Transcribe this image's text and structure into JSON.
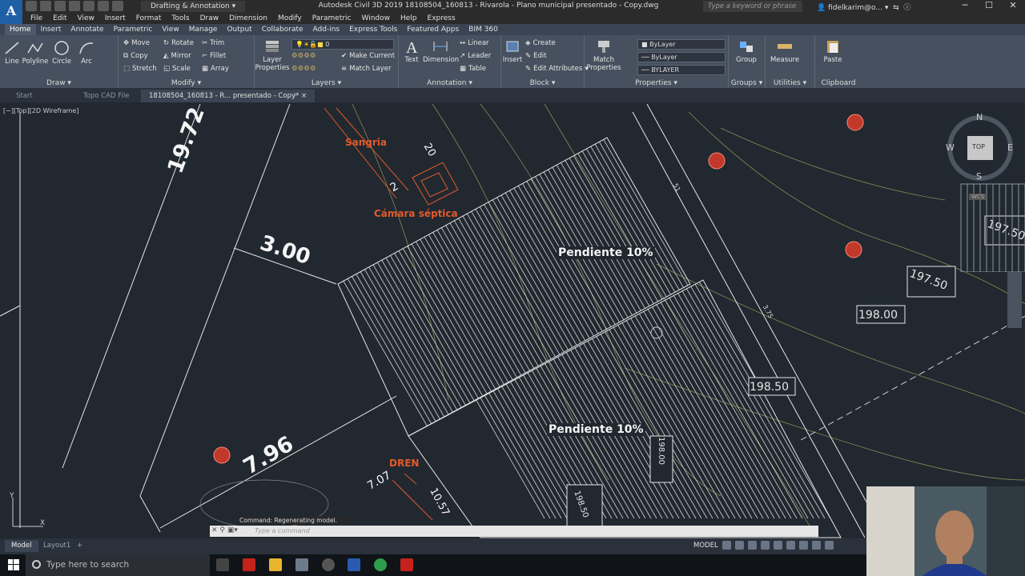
{
  "titlebar": {
    "app_letter": "A",
    "app_sub": "C3D",
    "workspace": "Drafting & Annotation",
    "title": "Autodesk Civil 3D 2019    18108504_160813 - Rivarola - Plano municipal      presentado - Copy.dwg",
    "search_placeholder": "Type a keyword or phrase",
    "user": "fidelkarim@o...",
    "minimize": "─",
    "maximize": "☐",
    "close": "✕"
  },
  "menubar": [
    "File",
    "Edit",
    "View",
    "Insert",
    "Format",
    "Tools",
    "Draw",
    "Dimension",
    "Modify",
    "Parametric",
    "Window",
    "Help",
    "Express"
  ],
  "ribbon_tabs": [
    "Home",
    "Insert",
    "Annotate",
    "Parametric",
    "View",
    "Manage",
    "Output",
    "Collaborate",
    "Add-ins",
    "Express Tools",
    "Featured Apps",
    "BIM 360"
  ],
  "ribbon": {
    "draw": {
      "title": "Draw",
      "line": "Line",
      "polyline": "Polyline",
      "circle": "Circle",
      "arc": "Arc"
    },
    "modify": {
      "title": "Modify",
      "move": "Move",
      "rotate": "Rotate",
      "trim": "Trim",
      "copy": "Copy",
      "mirror": "Mirror",
      "fillet": "Fillet",
      "stretch": "Stretch",
      "scale": "Scale",
      "array": "Array"
    },
    "layers": {
      "title": "Layers",
      "layer_properties_1": "Layer",
      "layer_properties_2": "Properties",
      "make_current": "Make Current",
      "match_layer": "Match Layer",
      "layer_value": "0"
    },
    "annotation": {
      "title": "Annotation",
      "text": "Text",
      "dimension": "Dimension",
      "linear": "Linear",
      "leader": "Leader",
      "table": "Table"
    },
    "block": {
      "title": "Block",
      "insert": "Insert",
      "create": "Create",
      "edit": "Edit",
      "edit_attributes": "Edit Attributes"
    },
    "properties": {
      "title": "Properties",
      "match_1": "Match",
      "match_2": "Properties",
      "color": "ByLayer",
      "linetype": "ByLayer",
      "lineweight": "BYLAYER"
    },
    "groups": {
      "title": "Groups",
      "group": "Group"
    },
    "utilities": {
      "title": "Utilities",
      "measure": "Measure"
    },
    "clipboard": {
      "title": "Clipboard",
      "paste": "Paste"
    }
  },
  "doc_tabs": [
    "Start",
    "Topo CAD File",
    "18108504_160813 - R... presentado - Copy*"
  ],
  "viewport_label": "[−][Top][2D Wireframe]",
  "drawing": {
    "dim_1972": "19.72",
    "dim_300": "3.00",
    "dim_796": "7.96",
    "dim_707": "7.07",
    "dim_1057": "10.57",
    "dim_20": "20",
    "dim_2": "2",
    "dim_51": "51",
    "dim_375": "3.75",
    "sangria": "Sangria",
    "camara": "Cámara séptica",
    "dren": "DREN",
    "pendiente_1": "Pendiente 10%",
    "pendiente_2": "Pendiente 10%",
    "elev_19750": "197.50",
    "elev_19800": "198.00",
    "elev_19850": "198.50",
    "elev_19750b": "197.50",
    "elev_19800v": "198.00",
    "elev_19850v": "198.50"
  },
  "viewcube": {
    "n": "N",
    "s": "S",
    "e": "E",
    "w": "W",
    "top": "TOP",
    "wcs": "WCS"
  },
  "command": {
    "history": "Command: Regenerating model.",
    "placeholder": "Type a command"
  },
  "layout_tabs": [
    "Model",
    "Layout1",
    "+"
  ],
  "status": {
    "model": "MODEL"
  },
  "taskbar": {
    "search": "Type here to search"
  }
}
